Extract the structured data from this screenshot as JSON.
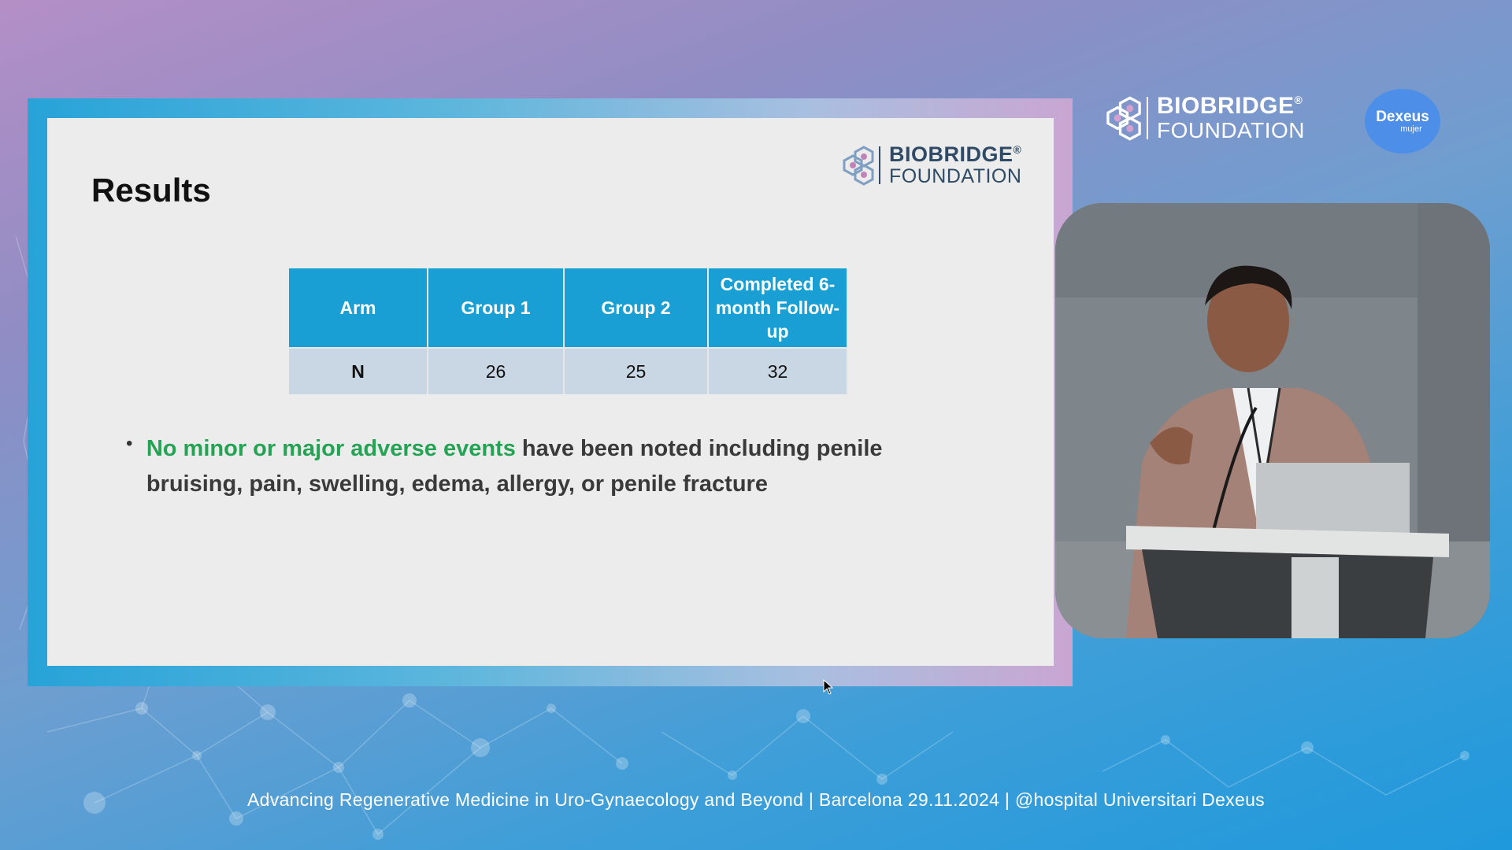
{
  "slide": {
    "title": "Results",
    "logo": {
      "line1": "BIOBRIDGE",
      "registered": "®",
      "line2": "FOUNDATION"
    },
    "table": {
      "headers": [
        "Arm",
        "Group 1",
        "Group 2",
        "Completed 6-month Follow-up"
      ],
      "row": {
        "label": "N",
        "values": [
          "26",
          "25",
          "32"
        ]
      }
    },
    "bullet": {
      "highlight": "No minor or major adverse events",
      "rest": " have been noted including penile bruising, pain, swelling, edema, allergy, or penile fracture"
    }
  },
  "branding": {
    "biobridge": {
      "line1": "BIOBRIDGE",
      "registered": "®",
      "line2": "FOUNDATION"
    },
    "dexeus": {
      "name": "Dexeus",
      "sub": "mujer"
    }
  },
  "footer": {
    "text": "Advancing Regenerative Medicine in Uro-Gynaecology and Beyond | Barcelona 29.11.2024 | @hospital Universitari Dexeus"
  },
  "icons": {
    "logo_mark": "hexagon-cluster-icon",
    "cursor": "mouse-pointer-icon"
  },
  "colors": {
    "table_header": "#199fd4",
    "table_row": "#c9d7e4",
    "highlight_green": "#25a354",
    "slide_bg": "#ececec"
  }
}
